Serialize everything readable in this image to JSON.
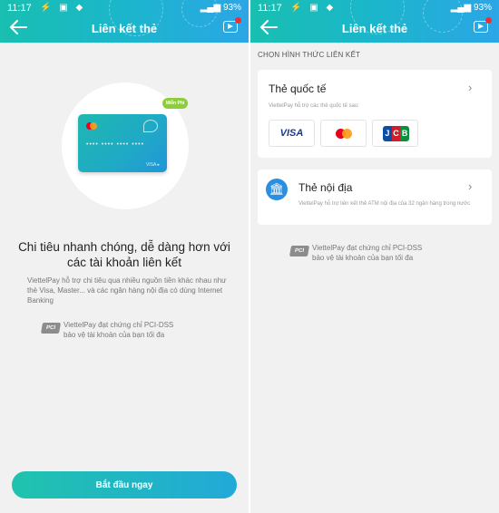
{
  "status_bar": {
    "time": "11:17",
    "battery": "93%"
  },
  "left": {
    "title": "Liên kết thẻ",
    "badge": "Miễn Phí",
    "headline_line1": "Chi tiêu nhanh chóng, dễ dàng hơn với",
    "headline_line2": "các tài khoản liên kết",
    "description": "ViettelPay hỗ trợ chi tiêu qua nhiều nguồn tiền khác nhau như thẻ Visa, Master... và các ngân hàng nội địa có dùng Internet Banking",
    "pci_label": "PCI",
    "pci_text": "ViettelPay đạt chứng chỉ PCI-DSS bảo vệ tài khoản của bạn tối đa",
    "cta": "Bắt đầu ngay"
  },
  "right": {
    "title": "Liên kết thẻ",
    "section_label": "CHỌN HÌNH THỨC LIÊN KẾT",
    "intl": {
      "title": "Thẻ quốc tế",
      "subtitle": "ViettelPay hỗ trợ các thẻ quốc tế sau:",
      "logos": [
        "VISA",
        "Mastercard",
        "JCB"
      ]
    },
    "domestic": {
      "title": "Thẻ nội địa",
      "subtitle": "ViettelPay hỗ trợ liên kết thẻ ATM nội địa của 32 ngân hàng trong nước"
    },
    "pci_label": "PCI",
    "pci_text": "ViettelPay đạt chứng chỉ PCI-DSS bảo vệ tài khoản của bạn tối đa"
  },
  "colors": {
    "accent_start": "#19bfb0",
    "accent_end": "#2ba6e6",
    "badge_green": "#8ccd3a",
    "notification_red": "#e8313a"
  },
  "icons": [
    "back-arrow-icon",
    "video-icon",
    "chevron-right-icon",
    "bank-icon",
    "pci-icon"
  ]
}
